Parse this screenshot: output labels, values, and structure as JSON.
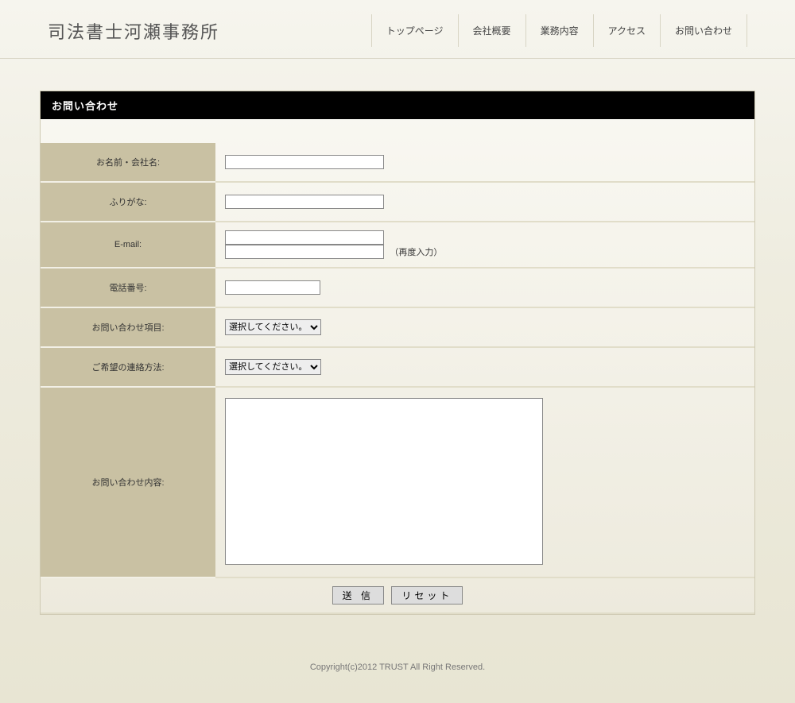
{
  "site_title": "司法書士河瀬事務所",
  "nav": {
    "items": [
      "トップページ",
      "会社概要",
      "業務内容",
      "アクセス",
      "お問い合わせ"
    ]
  },
  "section_title": "お問い合わせ",
  "form": {
    "rows": {
      "name": {
        "label": "お名前・会社名:",
        "value": ""
      },
      "kana": {
        "label": "ふりがな:",
        "value": ""
      },
      "email": {
        "label": "E-mail:",
        "value1": "",
        "value2": "",
        "note": "（再度入力）"
      },
      "tel": {
        "label": "電話番号:",
        "value": ""
      },
      "topic": {
        "label": "お問い合わせ項目:",
        "selected": "選択してください。"
      },
      "contact_method": {
        "label": "ご希望の連絡方法:",
        "selected": "選択してください。"
      },
      "body": {
        "label": "お問い合わせ内容:",
        "value": ""
      }
    },
    "buttons": {
      "submit": "送 信",
      "reset": "リセット"
    }
  },
  "footer": "Copyright(c)2012 TRUST All Right Reserved."
}
